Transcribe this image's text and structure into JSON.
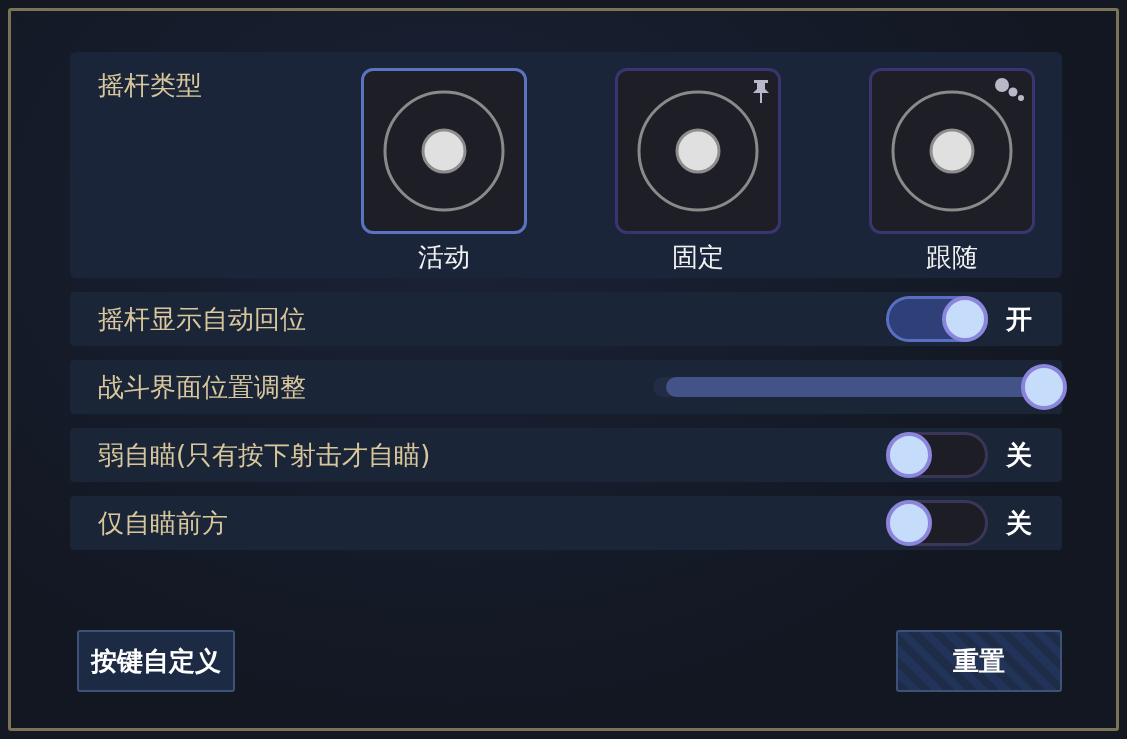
{
  "joystick_type": {
    "label": "摇杆类型",
    "options": [
      {
        "label": "活动",
        "selected": true,
        "kind": "plain"
      },
      {
        "label": "固定",
        "selected": false,
        "kind": "pin"
      },
      {
        "label": "跟随",
        "selected": false,
        "kind": "dots"
      }
    ]
  },
  "settings": [
    {
      "kind": "toggle",
      "label": "摇杆显示自动回位",
      "on": true,
      "state_text": "开"
    },
    {
      "kind": "slider",
      "label": "战斗界面位置调整",
      "level": 1.0
    },
    {
      "kind": "toggle",
      "label": "弱自瞄(只有按下射击才自瞄)",
      "on": false,
      "state_text": "关"
    },
    {
      "kind": "toggle",
      "label": "仅自瞄前方",
      "on": false,
      "state_text": "关"
    }
  ],
  "buttons": [
    {
      "label": "按键自定义",
      "kind": "plain"
    },
    {
      "label": "重置",
      "kind": "patterned"
    }
  ]
}
